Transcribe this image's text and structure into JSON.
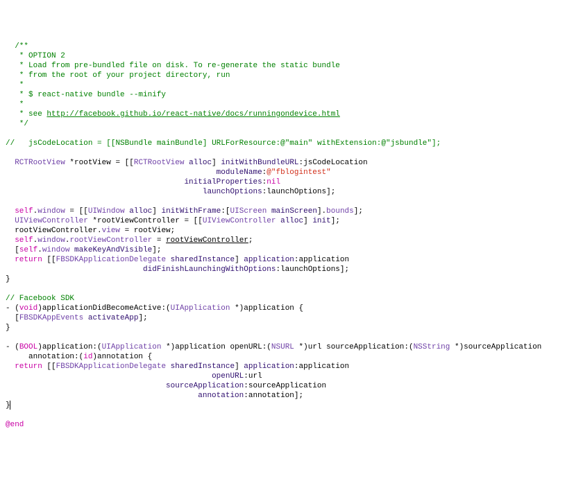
{
  "code": {
    "comment_block": {
      "l1": "  /**",
      "l2": "   * OPTION 2",
      "l3a": "   * Load from pre-bundled file on disk. To re-generate the static bundle",
      "l3b": "   * from the root of your project directory, run",
      "l4": "   *",
      "l5": "   * $ react-native bundle --minify",
      "l6": "   *",
      "l7_pre": "   * see ",
      "l7_link": "http://facebook.github.io/react-native/docs/runningondevice.html",
      "l8": "   */"
    },
    "jscode_loc_line": {
      "pre": "//   jsCodeLocation = [[",
      "nsbundle": "NSBundle",
      "mid1": " ",
      "mainbundle": "mainBundle",
      "mid2": "] ",
      "urlfor": "URLForResource",
      "mid3": ":",
      "at1": "@\"main\"",
      "mid4": " ",
      "withext": "withExtension",
      "mid5": ":",
      "at2": "@\"jsbundle\"",
      "end": "];"
    },
    "rootview_decl": {
      "type1": "RCTRootView",
      "txt1": " *rootView = [[",
      "type2": "RCTRootView",
      "txt2": " ",
      "alloc": "alloc",
      "txt3": "] ",
      "initwb": "initWithBundleURL",
      "txt4": ":jsCodeLocation",
      "line2_pad": "                                              ",
      "modulename": "moduleName",
      "txt5": ":",
      "fblogin": "@\"fblogintest\"",
      "line3_pad": "                                       ",
      "initialprops": "initialProperties",
      "txt6": ":",
      "nil": "nil",
      "line4_pad": "                                           ",
      "launchopts": "launchOptions",
      "txt7": ":launchOptions];"
    },
    "selfwindow": {
      "self": "self",
      "dot": ".",
      "window": "window",
      "txt1": " = [[",
      "uiwindow": "UIWindow",
      "txt2": " ",
      "alloc": "alloc",
      "txt3": "] ",
      "initframe": "initWithFrame",
      "txt4": ":[",
      "uiscreen": "UIScreen",
      "txt5": " ",
      "mainscreen": "mainScreen",
      "txt6": "].",
      "bounds": "bounds",
      "txt7": "];"
    },
    "rootvc_decl": {
      "type1": "UIViewController",
      "txt1": " *rootViewController = [[",
      "type2": "UIViewController",
      "txt2": " ",
      "alloc": "alloc",
      "txt3": "] ",
      "init": "init",
      "txt4": "];"
    },
    "rootvc_view": {
      "txt1": "  rootViewController.",
      "view": "view",
      "txt2": " = rootView;"
    },
    "selfwindow_rootvc": {
      "self": "self",
      "txt1": ".",
      "window": "window",
      "txt2": ".",
      "rootvc": "rootViewController",
      "txt3": " = ",
      "rootvc_u": "rootViewController",
      "txt4": ";"
    },
    "makekey": {
      "txt1": "  [",
      "self": "self",
      "txt2": ".",
      "window": "window",
      "txt3": " ",
      "mkv": "makeKeyAndVisible",
      "txt4": "];"
    },
    "return1": {
      "ret": "return",
      "txt1": " [[",
      "fbsdk": "FBSDKApplicationDelegate",
      "txt2": " ",
      "shared": "sharedInstance",
      "txt3": "] ",
      "app": "application",
      "txt4": ":application",
      "line2_pad": "                              ",
      "didfin": "didFinishLaunchingWithOptions",
      "txt5": ":launchOptions];"
    },
    "closebrace1": "}",
    "fbsdk_comment": "// Facebook SDK",
    "adb": {
      "dash": "- (",
      "void": "void",
      "txt1": ")applicationDidBecomeActive:(",
      "uiapp": "UIApplication",
      "txt2": " *)application {"
    },
    "activate": {
      "txt1": "  [",
      "fbae": "FBSDKAppEvents",
      "txt2": " ",
      "act": "activateApp",
      "txt3": "];"
    },
    "closebrace2": "}",
    "openurl_method": {
      "dash": "- (",
      "bool": "BOOL",
      "txt1": ")application:(",
      "uiapp": "UIApplication",
      "txt2": " *)application openURL:(",
      "nsurl": "NSURL",
      "txt3": " *)url sourceApplication:(",
      "nsstring": "NSString",
      "txt4": " *)sourceApplication",
      "line2_pad": "     annotation:(",
      "id": "id",
      "txt5": ")annotation {"
    },
    "return2": {
      "ret": "return",
      "txt1": " [[",
      "fbsdk": "FBSDKApplicationDelegate",
      "txt2": " ",
      "shared": "sharedInstance",
      "txt3": "] ",
      "app": "application",
      "txt4": ":application",
      "line2_pad": "                                             ",
      "openurl": "openURL",
      "txt5": ":url",
      "line3_pad": "                                   ",
      "srcapp": "sourceApplication",
      "txt6": ":sourceApplication",
      "line4_pad": "                                          ",
      "anno": "annotation",
      "txt7": ":annotation];"
    },
    "closebrace3_pre": "}",
    "end": "@end"
  }
}
